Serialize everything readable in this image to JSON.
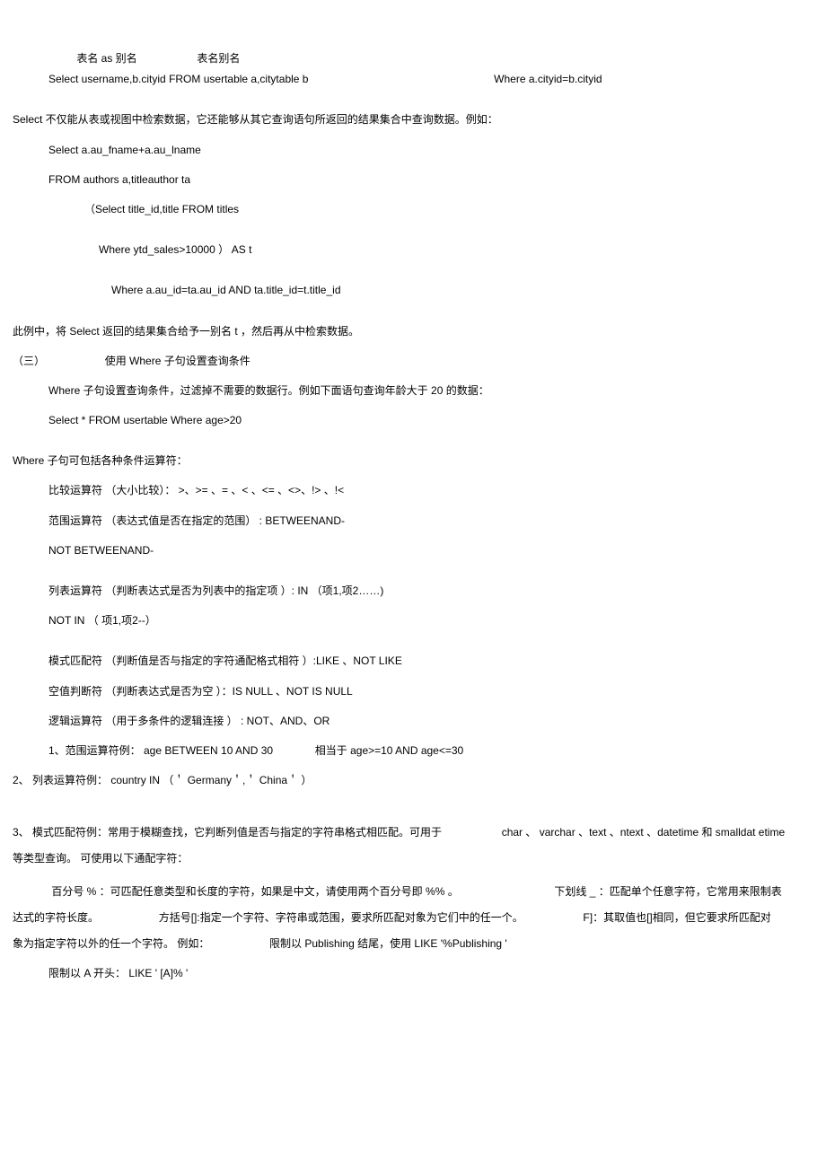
{
  "lines": {
    "l1a": "表名  as  别名",
    "l1b": "表名别名",
    "l2a": "Select username,b.cityid FROM usertable a,citytable b",
    "l2b": "Where a.cityid=b.cityid",
    "l3": "Select 不仅能从表或视图中检索数据，它还能够从其它查询语句所返回的结果集合中查询数据。例如：",
    "l4": "Select a.au_fname+a.au_lname",
    "l5": "FROM authors a,titleauthor ta",
    "l6": "（Select title_id,title FROM titles",
    "l7": "Where ytd_sales>10000 ） AS t",
    "l8": "Where a.au_id=ta.au_id AND ta.title_id=t.title_id",
    "l9": "此例中，将  Select 返回的结果集合给予一别名  t ，然后再从中检索数据。",
    "l10a": "（三）",
    "l10b": "使用  Where 子句设置查询条件",
    "l11": "Where 子句设置查询条件，过滤掉不需要的数据行。例如下面语句查询年龄大于  20 的数据：",
    "l12": "Select * FROM usertable Where age>20",
    "l13": "Where 子句可包括各种条件运算符：",
    "l14": "比较运算符 （大小比较）： >、>= 、= 、< 、<= 、<>、!> 、!<",
    "l15": "范围运算符 （表达式值是否在指定的范围） : BETWEENAND-",
    "l16": "NOT BETWEENAND-",
    "l17": "列表运算符 （判断表达式是否为列表中的指定项     ）: IN （项1,项2……)",
    "l18": "NOT IN （ 项1,项2--）",
    "l19": "模式匹配符   （判断值是否与指定的字符通配格式相符  ）:LIKE 、NOT LIKE",
    "l20": "空值判断符  （判断表达式是否为空  ）：IS NULL 、NOT IS NULL",
    "l21": "逻辑运算符   （用于多条件的逻辑连接  ） : NOT、AND、OR",
    "l22a": "1、范围运算符例：  age BETWEEN 10 AND 30",
    "l22b": "相当于  age>=10 AND age<=30",
    "l23": "2、 列表运算符例：  country IN （＇ Germany＇,＇ China＇ ）",
    "l24a": "3、 模式匹配符例：常用于模糊查找，它判断列值是否与指定的字符串格式相匹配。可用于",
    "l24b": "char 、 varchar 、text 、ntext 、datetime 和  smalldat etime",
    "l24c": "等类型查询。  可使用以下通配字符：",
    "l25a": "百分号  %  ：可匹配任意类型和长度的字符，如果是中文，请使用两个百分号即  %% 。",
    "l25b": "下划线  _  ：匹配单个任意字符，它常用来限制表",
    "l25c": "达式的字符长度。",
    "l25d": "方括号[]:指定一个字符、字符串或范围，要求所匹配对象为它们中的任一个。",
    "l25e": "F]：其取值也[]相同，但它要求所匹配对",
    "l25f": "象为指定字符以外的任一个字符。  例如：",
    "l25g": "限制以  Publishing 结尾，使用  LIKE '%Publishing '",
    "l26": "限制以  A 开头：  LIKE ' [A]% '"
  }
}
